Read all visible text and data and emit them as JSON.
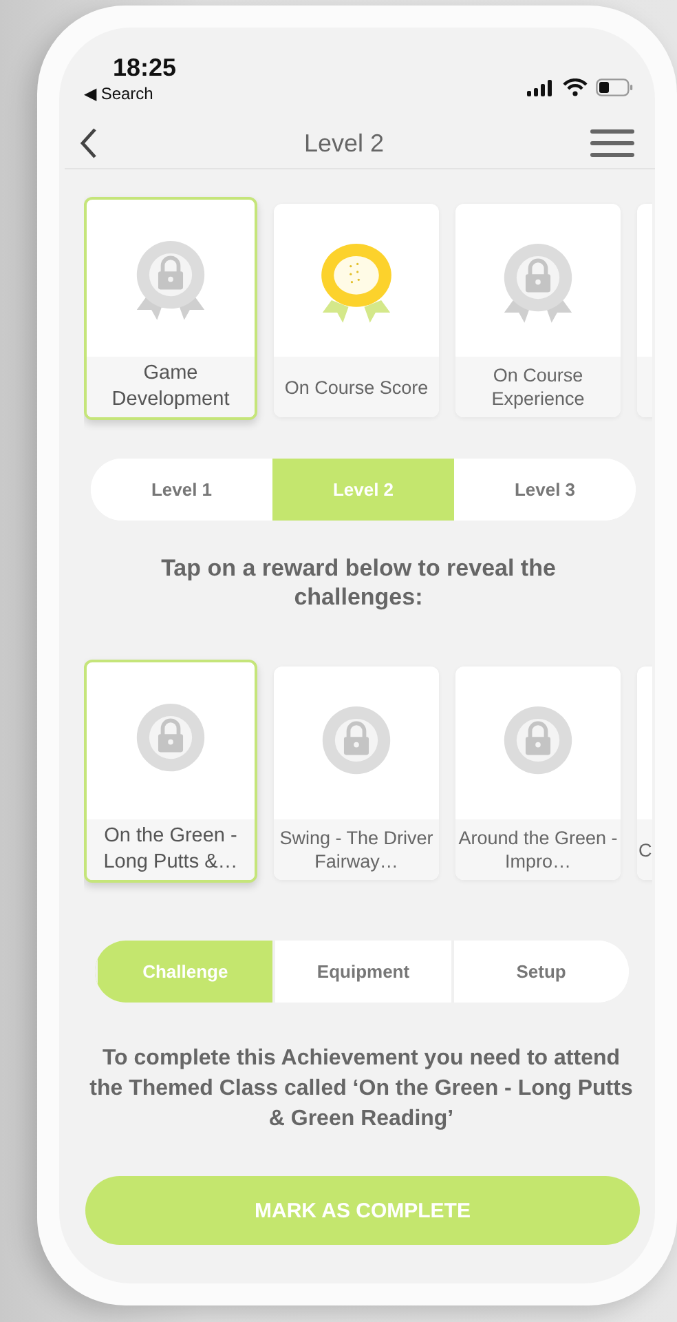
{
  "status_bar": {
    "time": "18:25",
    "back_label": "◀ Search"
  },
  "nav": {
    "title": "Level 2"
  },
  "awards": [
    {
      "label": "Game Development",
      "kind": "locked",
      "selected": true
    },
    {
      "label": "On Course Score",
      "kind": "gold",
      "selected": false
    },
    {
      "label": "On Course Experience",
      "kind": "locked",
      "selected": false
    },
    {
      "selected": false
    }
  ],
  "level_tabs": [
    {
      "label": "Level 1",
      "selected": false
    },
    {
      "label": "Level 2",
      "selected": true
    },
    {
      "label": "Level 3",
      "selected": false
    }
  ],
  "instruction": "Tap on a reward below to reveal the challenges:",
  "challenges": [
    {
      "label": "On the Green - Long Putts &…",
      "kind": "locked",
      "selected": true
    },
    {
      "label": "Swing - The Driver Fairway…",
      "kind": "locked",
      "selected": false
    },
    {
      "label": "Around the Green - Impro…",
      "kind": "locked",
      "selected": false
    },
    {
      "label": "C",
      "selected": false
    }
  ],
  "info_tabs": [
    {
      "label": "Challenge",
      "selected": true
    },
    {
      "label": "Equipment",
      "selected": false
    },
    {
      "label": "Setup",
      "selected": false
    }
  ],
  "description": "To complete this Achievement you need to attend the Themed Class called ‘On the Green - Long Putts & Green Reading’",
  "action_button": "MARK AS COMPLETE"
}
